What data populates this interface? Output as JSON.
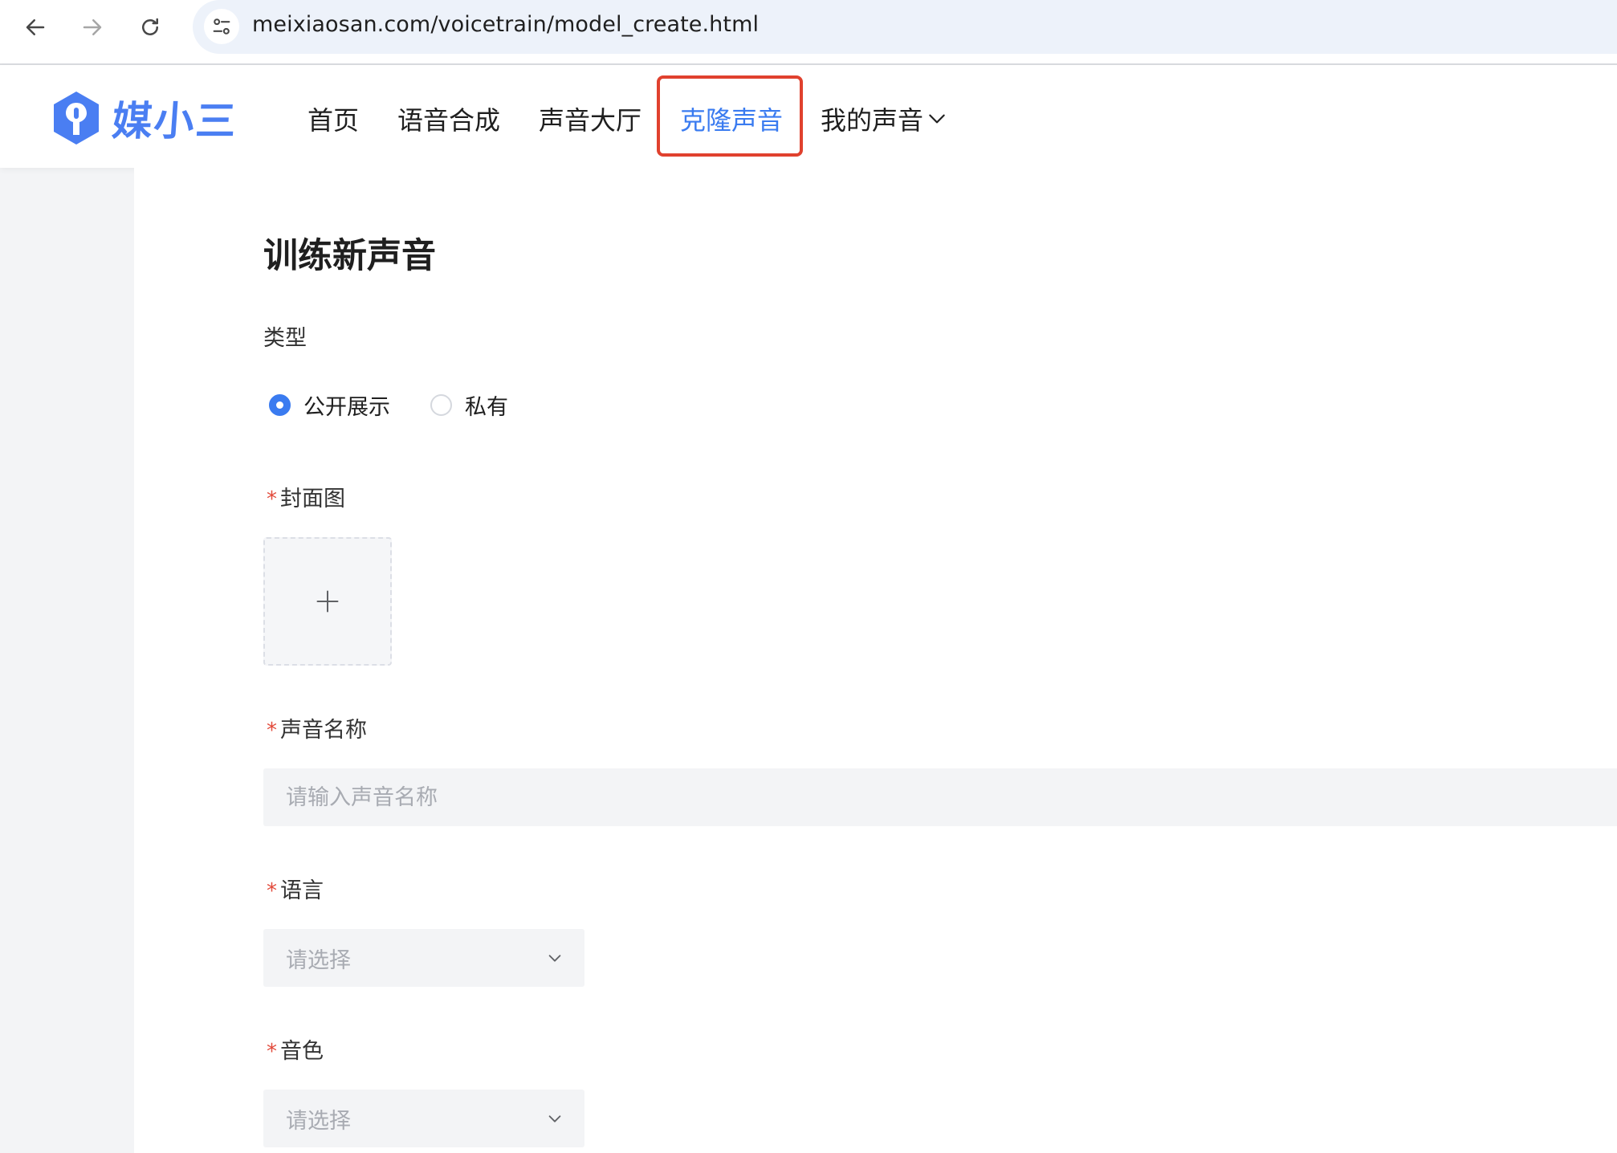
{
  "browser": {
    "url": "meixiaosan.com/voicetrain/model_create.html"
  },
  "site": {
    "logo_text": "媒小三",
    "brand_color": "#3a7bf0",
    "nav": {
      "home": "首页",
      "tts": "语音合成",
      "hall": "声音大厅",
      "clone": "克隆声音",
      "mine": "我的声音"
    }
  },
  "form": {
    "title": "训练新声音",
    "type": {
      "label": "类型",
      "options": [
        "公开展示",
        "私有"
      ],
      "selected": "公开展示"
    },
    "cover": {
      "label": "封面图",
      "required_mark": "*"
    },
    "name": {
      "label": "声音名称",
      "required_mark": "*",
      "placeholder": "请输入声音名称"
    },
    "language": {
      "label": "语言",
      "required_mark": "*",
      "placeholder": "请选择"
    },
    "timbre": {
      "label": "音色",
      "required_mark": "*",
      "placeholder": "请选择"
    }
  }
}
